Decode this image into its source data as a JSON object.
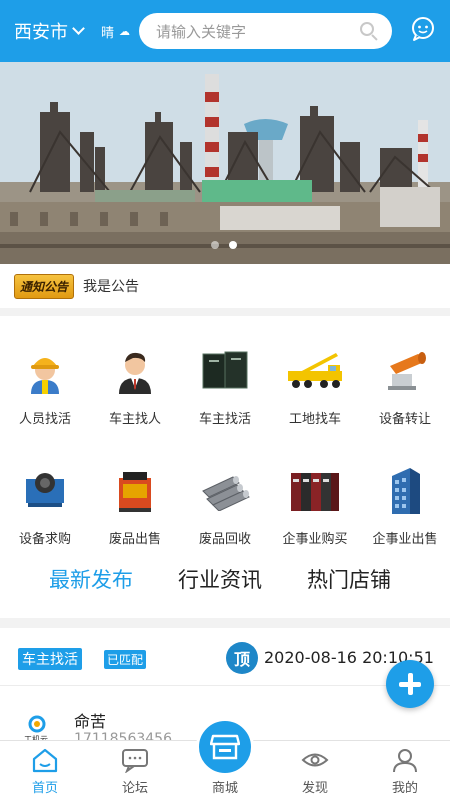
{
  "header": {
    "city": "西安市",
    "weather": "晴",
    "search_placeholder": "请输入关键字"
  },
  "notice": {
    "badge": "通知公告",
    "text": "我是公告"
  },
  "grid": [
    {
      "label": "人员找活",
      "icon": "worker-helmet-icon"
    },
    {
      "label": "车主找人",
      "icon": "businessman-icon"
    },
    {
      "label": "车主找活",
      "icon": "black-documents-icon"
    },
    {
      "label": "工地找车",
      "icon": "crane-truck-icon"
    },
    {
      "label": "设备转让",
      "icon": "mist-cannon-icon"
    },
    {
      "label": "设备求购",
      "icon": "winch-machine-icon"
    },
    {
      "label": "废品出售",
      "icon": "red-machine-icon"
    },
    {
      "label": "废品回收",
      "icon": "steel-pipes-icon"
    },
    {
      "label": "企事业购买",
      "icon": "binders-icon"
    },
    {
      "label": "企事业出售",
      "icon": "office-building-icon"
    }
  ],
  "tabs": [
    "最新发布",
    "行业资讯",
    "热门店铺"
  ],
  "feed": {
    "category_tag": "车主找活",
    "status_tag": "已匹配",
    "top_badge": "顶",
    "date": "2020-08-16 20:10:51",
    "post_logo_text": "工机云",
    "post_name": "命苦",
    "post_phone": "17118563456"
  },
  "bottom_nav": [
    "首页",
    "论坛",
    "商城",
    "发现",
    "我的"
  ],
  "colors": {
    "accent": "#1e9ee8"
  }
}
